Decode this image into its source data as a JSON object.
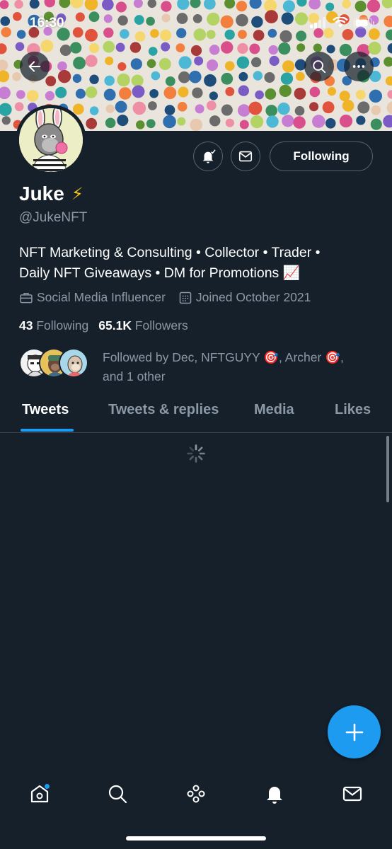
{
  "status_bar": {
    "time": "16:30"
  },
  "profile": {
    "display_name": "Juke",
    "display_name_emoji": "⚡",
    "handle": "@JukeNFT",
    "bio_line1": "NFT Marketing & Consulting • Collector • Trader •",
    "bio_line2": "Daily NFT Giveaways • DM for Promotions 📈",
    "category": "Social Media Influencer",
    "joined": "Joined October 2021",
    "following_count": "43",
    "following_label": "Following",
    "followers_count": "65.1K",
    "followers_label": "Followers",
    "followed_by_line1": "Followed by Dec, NFTGUYY 🎯, Archer 🎯,",
    "followed_by_line2": "and 1 other"
  },
  "actions": {
    "following_button": "Following"
  },
  "tabs": [
    {
      "label": "Tweets",
      "active": true
    },
    {
      "label": "Tweets & replies",
      "active": false
    },
    {
      "label": "Media",
      "active": false
    },
    {
      "label": "Likes",
      "active": false
    }
  ],
  "bottom_nav": [
    "home-icon",
    "search-icon",
    "spaces-icon",
    "notifications-icon",
    "messages-icon"
  ],
  "colors": {
    "background": "#15202b",
    "accent": "#1d9bf0",
    "muted": "#8b98a5",
    "border": "#38444d"
  }
}
